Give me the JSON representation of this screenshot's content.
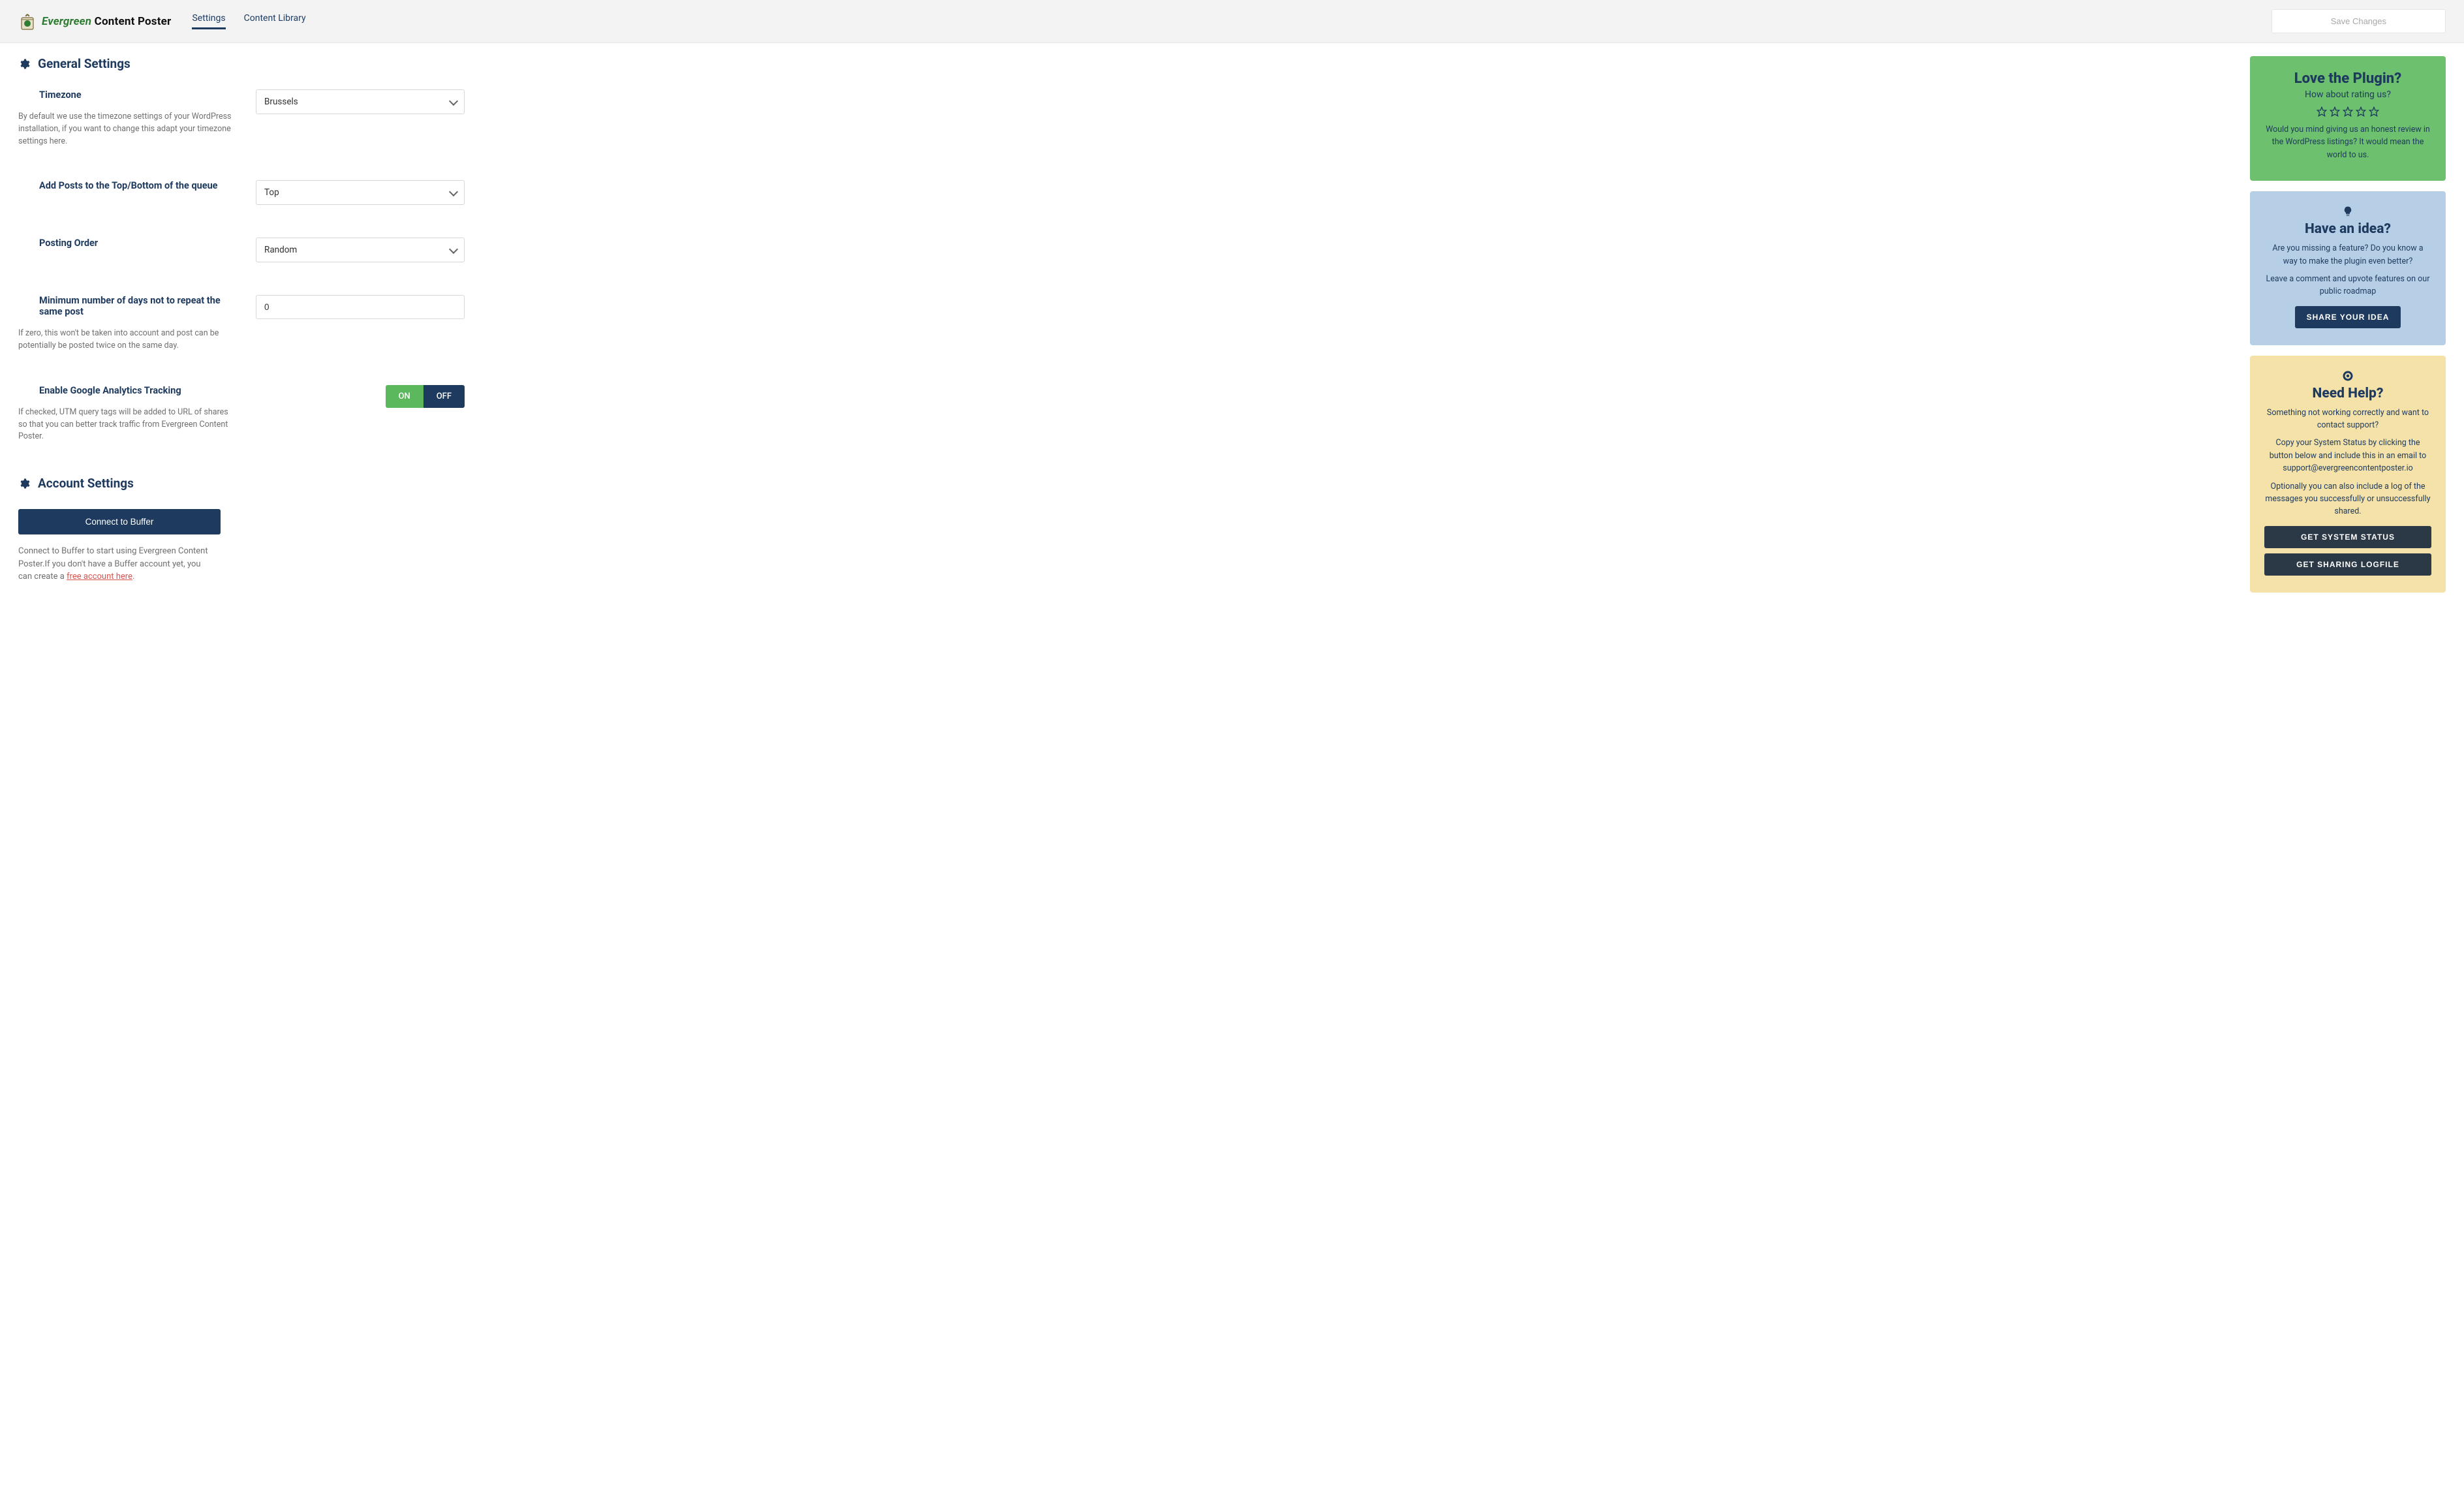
{
  "header": {
    "logo_text_green": "Evergreen",
    "logo_text_black": " Content Poster",
    "tabs": {
      "settings": "Settings",
      "library": "Content Library"
    },
    "save_label": "Save Changes"
  },
  "sections": {
    "general_title": "General Settings",
    "account_title": "Account Settings"
  },
  "general": {
    "timezone": {
      "label": "Timezone",
      "value": "Brussels",
      "help": "By default we use the timezone settings of your WordPress installation, if you want to change this adapt your timezone settings here."
    },
    "queue_position": {
      "label": "Add Posts to the Top/Bottom of the queue",
      "value": "Top"
    },
    "posting_order": {
      "label": "Posting Order",
      "value": "Random"
    },
    "min_days": {
      "label": "Minimum number of days not to repeat the same post",
      "value": "0",
      "help": "If zero, this won't be taken into account and post can be potentially be posted twice on the same day."
    },
    "ga_tracking": {
      "label": "Enable Google Analytics Tracking",
      "on": "ON",
      "off": "OFF",
      "help": "If checked, UTM query tags will be added to URL of shares so that you can better track traffic from Evergreen Content Poster."
    }
  },
  "account": {
    "connect_label": "Connect to Buffer",
    "help_pre": "Connect to Buffer to start using Evergreen Content Poster.If you don't have a Buffer account yet, you can create a ",
    "help_link": "free account here",
    "help_post": "."
  },
  "rating_card": {
    "title": "Love the Plugin?",
    "subtitle": "How about rating us?",
    "body": "Would you mind giving us an honest review in the WordPress listings? It would mean the world to us."
  },
  "idea_card": {
    "title": "Have an idea?",
    "p1": "Are you missing a feature? Do you know a way to make the plugin even better?",
    "p2": "Leave a comment and upvote features on our public roadmap",
    "button": "SHARE YOUR IDEA"
  },
  "help_card": {
    "title": "Need Help?",
    "p1": "Something not working correctly and want to contact support?",
    "p2": "Copy your System Status by clicking the button below and include this in an email to support@evergreencontentposter.io",
    "p3": "Optionally you can also include a log of the messages you successfully or unsuccessfully shared.",
    "button1": "GET SYSTEM STATUS",
    "button2": "GET SHARING LOGFILE"
  }
}
